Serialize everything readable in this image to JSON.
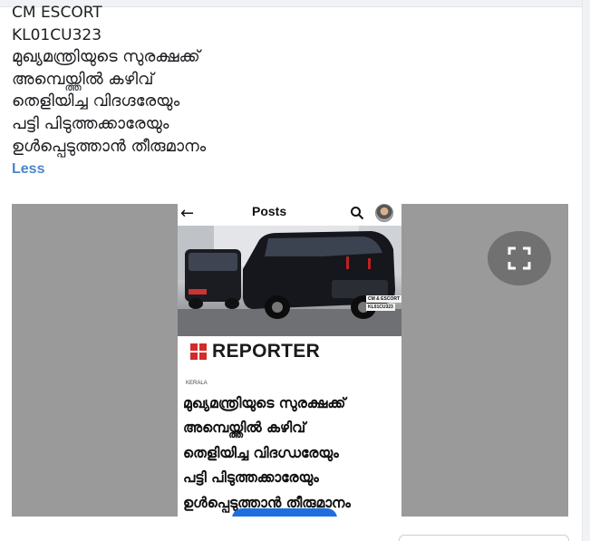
{
  "post": {
    "lines": [
      "CM ESCORT",
      "KL01CU323",
      "മുഖ്യമന്ത്രിയുടെ സുരക്ഷക്ക്",
      "അമ്പെയ്ത്തിൽ കഴിവ്",
      "തെളിയിച്ച വിദഗ്ദരേയും",
      "പട്ടി പിടുത്തക്കാരേയും",
      "ഉൾപ്പെടുത്താൻ തീരുമാനം"
    ],
    "less_label": "Less"
  },
  "media": {
    "phone": {
      "header_title": "Posts",
      "back_icon": "arrow-left-icon",
      "search_icon": "search-icon",
      "plate_label_1": "CM & ESCORT",
      "plate_label_2": "KL01CU323",
      "source_logo": "REPORTER",
      "category": "KERALA",
      "headline_lines": [
        "മുഖ്യമന്ത്രിയുടെ സുരക്ഷക്ക്",
        "അമ്പെയ്ത്തിൽ കഴിവ്",
        "തെളിയിച്ച വിദഗ്ധരേയും",
        "പട്ടി പിടുത്തക്കാരേയും",
        "ഉൾപ്പെടുത്താൻ തീരുമാനം"
      ]
    },
    "fullscreen_icon": "fullscreen-icon"
  },
  "colors": {
    "link": "#4a86c9",
    "media_bg": "#9a9a9a",
    "reporter_red": "#d42a2a",
    "phone_button": "#1f6ee0"
  }
}
